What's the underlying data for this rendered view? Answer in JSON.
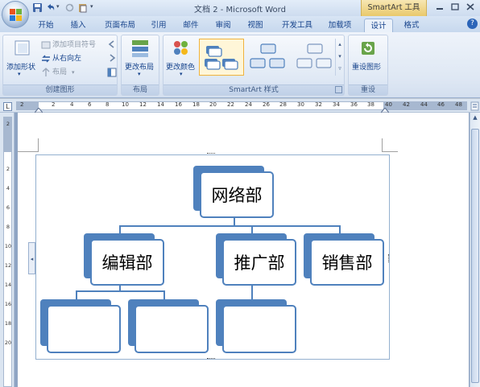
{
  "window": {
    "title": "文档 2 - Microsoft Word",
    "contextual_tool": "SmartArt 工具"
  },
  "tabs": [
    {
      "label": "开始"
    },
    {
      "label": "插入"
    },
    {
      "label": "页面布局"
    },
    {
      "label": "引用"
    },
    {
      "label": "邮件"
    },
    {
      "label": "审阅"
    },
    {
      "label": "视图"
    },
    {
      "label": "开发工具"
    },
    {
      "label": "加载项"
    },
    {
      "label": "设计",
      "active": true
    },
    {
      "label": "格式"
    }
  ],
  "ribbon": {
    "create_graphic": {
      "label": "创建图形",
      "add_shape": "添加形状",
      "add_bullet": "添加项目符号",
      "right_to_left": "从右向左",
      "layout": "布局"
    },
    "layouts": {
      "label": "布局",
      "change_layout": "更改布局"
    },
    "smartart_styles": {
      "label": "SmartArt 样式",
      "change_colors": "更改颜色"
    },
    "reset": {
      "label": "重设",
      "reset_graphic": "重设图形"
    }
  },
  "ruler": {
    "corner": "L",
    "ticks": [
      "2",
      "2",
      "4",
      "6",
      "8",
      "10",
      "12",
      "14",
      "16",
      "18",
      "20",
      "22",
      "24",
      "26",
      "28",
      "30",
      "32",
      "34",
      "36",
      "38",
      "40",
      "42",
      "44",
      "46",
      "48"
    ],
    "vticks": [
      "2",
      "2",
      "4",
      "6",
      "8",
      "10",
      "12",
      "14",
      "16",
      "18",
      "20"
    ]
  },
  "smartart": {
    "root": "网络部",
    "level2": [
      "编辑部",
      "推广部",
      "销售部"
    ],
    "level3_placeholders": [
      "",
      "",
      ""
    ]
  },
  "colors": {
    "accent": "#4f81bd",
    "ribbon_bg": "#dfe8f4",
    "contextual_tab": "#e9c96b"
  }
}
